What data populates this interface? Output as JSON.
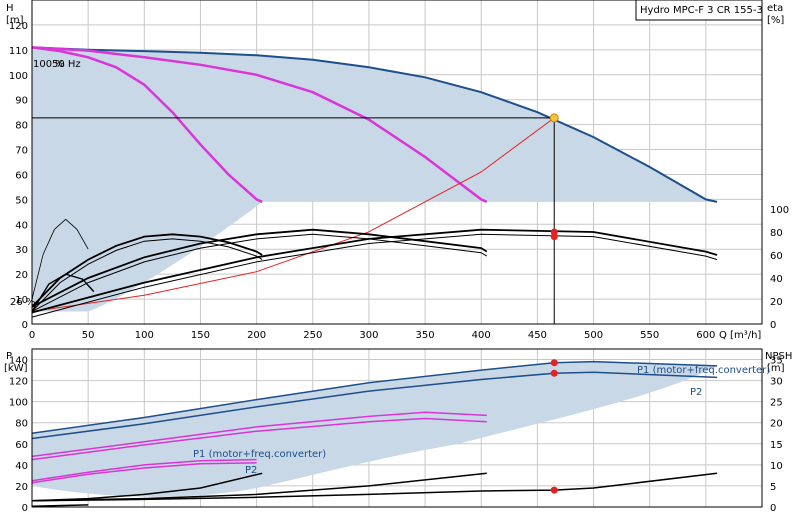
{
  "chart_data": [
    {
      "type": "line",
      "id": "head",
      "pump_label": "Hydro MPC-F 3 CR 155-3",
      "left_axis": {
        "label": "H",
        "unit": "[m]",
        "ticks": [
          0,
          10,
          20,
          30,
          40,
          50,
          60,
          70,
          80,
          90,
          100,
          110,
          120
        ],
        "range": [
          0,
          130
        ]
      },
      "right_axis": {
        "label": "eta",
        "unit": "[%]",
        "ticks": [
          0,
          20,
          40,
          60,
          80,
          100
        ],
        "range_note": "0–100 on lower part"
      },
      "x_axis": {
        "label": "Q [m³/h]",
        "ticks": [
          0,
          50,
          100,
          150,
          200,
          250,
          300,
          350,
          400,
          450,
          500,
          550,
          600
        ],
        "range": [
          0,
          650
        ]
      },
      "annotations": {
        "speed_top": "100 %",
        "frequency": "50 Hz",
        "speed_bottom": "26 %"
      },
      "duty_point": {
        "q": 465,
        "h": 82.7
      },
      "series": [
        {
          "role": "envelope",
          "color": "#1d4f8a",
          "x": [
            0,
            50,
            100,
            150,
            200,
            250,
            300,
            350,
            400,
            450,
            500,
            550,
            600,
            610
          ],
          "y": [
            111,
            110,
            109.5,
            108.8,
            107.8,
            106,
            103,
            99,
            93,
            85,
            75,
            63,
            50,
            49
          ]
        },
        {
          "role": "pump-2",
          "color": "#d935d9",
          "x": [
            0,
            50,
            100,
            150,
            200,
            250,
            300,
            350,
            400,
            405
          ],
          "y": [
            111,
            109.7,
            107,
            104,
            100,
            93,
            82,
            67,
            50,
            49
          ]
        },
        {
          "role": "pump-1",
          "color": "#d935d9",
          "x": [
            0,
            25,
            50,
            75,
            100,
            125,
            150,
            175,
            200,
            205
          ],
          "y": [
            111,
            109.5,
            107,
            103,
            96,
            85,
            72,
            60,
            50,
            49
          ]
        },
        {
          "role": "system-curve",
          "color": "#e32222",
          "x": [
            0,
            100,
            200,
            300,
            400,
            465
          ],
          "y": [
            5,
            11.5,
            21,
            37,
            61,
            82.7
          ]
        },
        {
          "role": "eta-3",
          "color": "#000000",
          "x": [
            0,
            100,
            200,
            300,
            400,
            500,
            600,
            610
          ],
          "eta": [
            10,
            36,
            58,
            74,
            82,
            80,
            63,
            60
          ]
        },
        {
          "role": "eta-2",
          "color": "#000000",
          "x": [
            0,
            50,
            100,
            150,
            200,
            250,
            300,
            350,
            400,
            405
          ],
          "eta": [
            15,
            40,
            58,
            70,
            78,
            82,
            78,
            72,
            66,
            63
          ]
        },
        {
          "role": "eta-1",
          "color": "#000000",
          "x": [
            0,
            25,
            50,
            75,
            100,
            125,
            150,
            175,
            200,
            205
          ],
          "eta": [
            15,
            40,
            56,
            68,
            76,
            78,
            76,
            71,
            63,
            60
          ]
        }
      ],
      "duty_eta": [
        80,
        76
      ]
    },
    {
      "type": "line",
      "id": "power",
      "left_axis": {
        "label": "P",
        "unit": "[kW]",
        "ticks": [
          0,
          20,
          40,
          60,
          80,
          100,
          120,
          140
        ],
        "range": [
          0,
          150
        ]
      },
      "right_axis": {
        "label": "NPSH",
        "unit": "[m]",
        "ticks": [
          0,
          5,
          10,
          15,
          20,
          25,
          30,
          35
        ],
        "range": [
          0,
          37.5
        ]
      },
      "series_labels": {
        "p1_main": "P1 (motor+freq.converter)",
        "p2_main": "P2",
        "p1_small": "P1 (motor+freq.converter)",
        "p2_small": "P2"
      },
      "series": [
        {
          "role": "p1-3",
          "color": "#1d4f8a",
          "x": [
            0,
            100,
            200,
            300,
            400,
            465,
            500,
            610
          ],
          "y": [
            70,
            85,
            102,
            118,
            130,
            137,
            138,
            134
          ]
        },
        {
          "role": "p2-3",
          "color": "#1d4f8a",
          "x": [
            0,
            100,
            200,
            300,
            400,
            465,
            500,
            610
          ],
          "y": [
            65,
            79,
            95,
            110,
            121,
            127,
            128,
            123
          ]
        },
        {
          "role": "p1-2",
          "color": "#d935d9",
          "x": [
            0,
            100,
            200,
            300,
            350,
            405
          ],
          "y": [
            48,
            62,
            76,
            86,
            90,
            87
          ]
        },
        {
          "role": "p2-2",
          "color": "#d935d9",
          "x": [
            0,
            100,
            200,
            300,
            350,
            405
          ],
          "y": [
            45,
            59,
            72,
            81,
            84,
            81
          ]
        },
        {
          "role": "p1-1",
          "color": "#d935d9",
          "x": [
            0,
            50,
            100,
            150,
            200
          ],
          "y": [
            25,
            33,
            40,
            44,
            45
          ]
        },
        {
          "role": "p2-1",
          "color": "#d935d9",
          "x": [
            0,
            50,
            100,
            150,
            200
          ],
          "y": [
            23,
            31,
            37,
            41,
            42
          ]
        },
        {
          "role": "npsh-3",
          "color": "#000000",
          "x": [
            0,
            100,
            200,
            300,
            400,
            465,
            500,
            610
          ],
          "npsh": [
            1.5,
            1.8,
            2.3,
            3,
            3.8,
            4,
            4.5,
            8
          ]
        },
        {
          "role": "npsh-2",
          "color": "#000000",
          "x": [
            0,
            100,
            200,
            300,
            405
          ],
          "npsh": [
            1.5,
            2,
            3,
            5,
            8
          ]
        },
        {
          "role": "npsh-1",
          "color": "#000000",
          "x": [
            0,
            50,
            100,
            150,
            205
          ],
          "npsh": [
            1.5,
            2,
            3,
            4.5,
            8
          ]
        },
        {
          "role": "npsh-0",
          "color": "#000000",
          "x": [
            0,
            50
          ],
          "npsh": [
            0.2,
            0.5
          ]
        }
      ],
      "duty_power": [
        137,
        127
      ],
      "duty_npsh": 4
    }
  ]
}
